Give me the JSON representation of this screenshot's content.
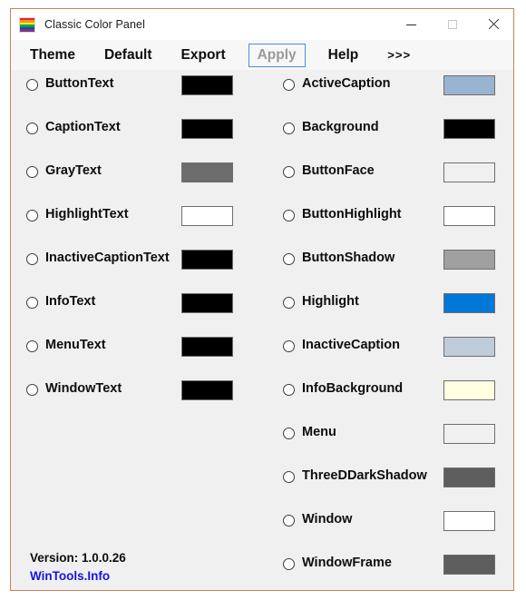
{
  "window": {
    "title": "Classic Color Panel",
    "icon": "rainbow-flag-icon",
    "border_color": "#c4825a",
    "background_color": "#f0f0f0",
    "controls": {
      "minimize": "minimize-icon",
      "maximize": "maximize-icon",
      "close": "close-icon"
    }
  },
  "menu": {
    "items": [
      {
        "label": "Theme",
        "disabled": false,
        "focused": false
      },
      {
        "label": "Default",
        "disabled": false,
        "focused": false
      },
      {
        "label": "Export",
        "disabled": false,
        "focused": false
      },
      {
        "label": "Apply",
        "disabled": true,
        "focused": true
      },
      {
        "label": "Help",
        "disabled": false,
        "focused": false
      },
      {
        "label": ">>>",
        "disabled": false,
        "focused": false
      }
    ]
  },
  "left_column": [
    {
      "label": "ButtonText",
      "color": "#000000",
      "selected": false
    },
    {
      "label": "CaptionText",
      "color": "#000000",
      "selected": false
    },
    {
      "label": "GrayText",
      "color": "#6d6d6d",
      "selected": false
    },
    {
      "label": "HighlightText",
      "color": "#ffffff",
      "selected": false
    },
    {
      "label": "InactiveCaptionText",
      "color": "#000000",
      "selected": false
    },
    {
      "label": "InfoText",
      "color": "#000000",
      "selected": false
    },
    {
      "label": "MenuText",
      "color": "#000000",
      "selected": false
    },
    {
      "label": "WindowText",
      "color": "#000000",
      "selected": false
    }
  ],
  "right_column": [
    {
      "label": "ActiveCaption",
      "color": "#99b4d1",
      "selected": false
    },
    {
      "label": "Background",
      "color": "#000000",
      "selected": false
    },
    {
      "label": "ButtonFace",
      "color": "#f0f0f0",
      "selected": false
    },
    {
      "label": "ButtonHighlight",
      "color": "#ffffff",
      "selected": false
    },
    {
      "label": "ButtonShadow",
      "color": "#a0a0a0",
      "selected": false
    },
    {
      "label": "Highlight",
      "color": "#0078d7",
      "selected": false
    },
    {
      "label": "InactiveCaption",
      "color": "#bfcddb",
      "selected": false
    },
    {
      "label": "InfoBackground",
      "color": "#ffffe1",
      "selected": false
    },
    {
      "label": "Menu",
      "color": "#f0f0f0",
      "selected": false
    },
    {
      "label": "ThreeDDarkShadow",
      "color": "#5e5e5e",
      "selected": false
    },
    {
      "label": "Window",
      "color": "#ffffff",
      "selected": false
    },
    {
      "label": "WindowFrame",
      "color": "#5e5e5e",
      "selected": false
    }
  ],
  "footer": {
    "version": "Version: 1.0.0.26",
    "link": "WinTools.Info",
    "link_color": "#1414e6"
  },
  "icon_stripes": [
    "#e8242b",
    "#f7941e",
    "#fff200",
    "#00a651",
    "#0054a6",
    "#8d2a8f"
  ]
}
